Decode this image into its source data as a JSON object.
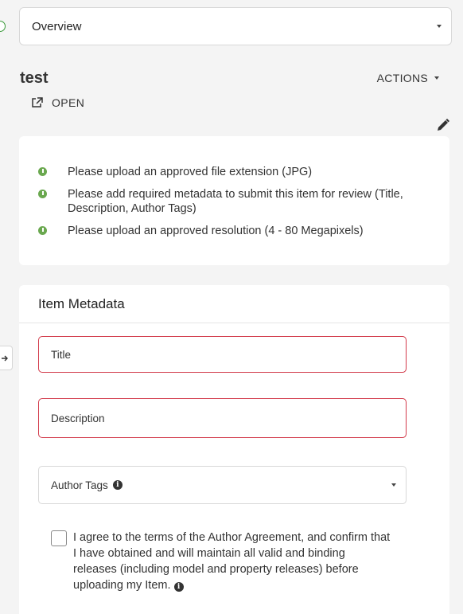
{
  "top_select": {
    "value": "Overview"
  },
  "item": {
    "title": "test"
  },
  "actions": {
    "label": "ACTIONS"
  },
  "open": {
    "label": "OPEN"
  },
  "alerts": [
    "Please upload an approved file extension (JPG)",
    "Please add required metadata to submit this item for review (Title, Description, Author Tags)",
    "Please upload an approved resolution (4 - 80 Megapixels)"
  ],
  "metadata": {
    "heading": "Item Metadata",
    "title_placeholder": "Title",
    "description_placeholder": "Description",
    "author_tags_label": "Author Tags",
    "agreement_text": "I agree to the terms of the Author Agreement, and confirm that I have obtained and will maintain all valid and binding releases (including model and property releases) before uploading my Item."
  },
  "colors": {
    "alert_dot": "#6aa84f",
    "error_border": "#d23a4a"
  },
  "icons": [
    "external-link-icon",
    "pencil-icon",
    "info-icon",
    "arrow-right-icon",
    "status-dot-icon"
  ]
}
